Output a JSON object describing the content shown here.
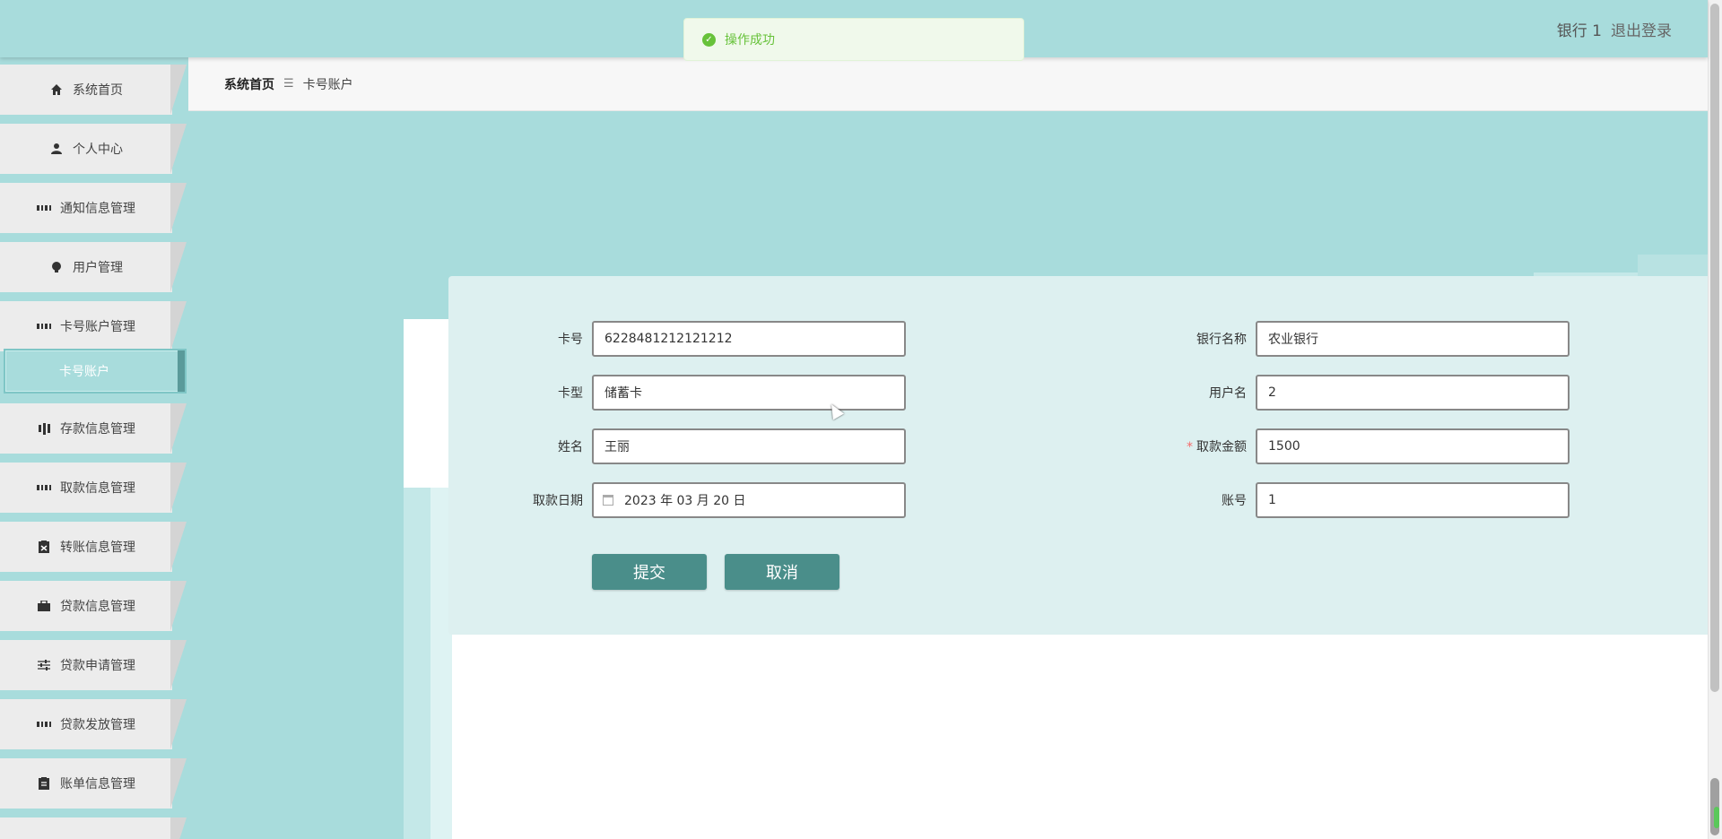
{
  "toast": {
    "message": "操作成功"
  },
  "header": {
    "user": "银行 1",
    "logout": "退出登录"
  },
  "sidebar": {
    "items": [
      {
        "label": "系统首页",
        "icon": "home-icon"
      },
      {
        "label": "个人中心",
        "icon": "user-icon"
      },
      {
        "label": "通知信息管理",
        "icon": "grid-icon"
      },
      {
        "label": "用户管理",
        "icon": "bulb-icon"
      },
      {
        "label": "卡号账户管理",
        "icon": "grid-icon"
      },
      {
        "label": "存款信息管理",
        "icon": "bar-chart-icon"
      },
      {
        "label": "取款信息管理",
        "icon": "grid-icon"
      },
      {
        "label": "转账信息管理",
        "icon": "clipboard-icon"
      },
      {
        "label": "贷款信息管理",
        "icon": "briefcase-icon"
      },
      {
        "label": "贷款申请管理",
        "icon": "sliders-icon"
      },
      {
        "label": "贷款发放管理",
        "icon": "grid-icon"
      },
      {
        "label": "账单信息管理",
        "icon": "clipboard-icon"
      }
    ],
    "active_sub": "卡号账户"
  },
  "breadcrumb": {
    "home": "系统首页",
    "separator": "☰",
    "current": "卡号账户"
  },
  "form": {
    "card_no": {
      "label": "卡号",
      "value": "6228481212121212"
    },
    "bank_name": {
      "label": "银行名称",
      "value": "农业银行"
    },
    "card_type": {
      "label": "卡型",
      "value": "储蓄卡"
    },
    "username": {
      "label": "用户名",
      "value": "2"
    },
    "name": {
      "label": "姓名",
      "value": "王丽"
    },
    "amount": {
      "label": "取款金额",
      "value": "1500",
      "required": "*"
    },
    "date": {
      "label": "取款日期",
      "value": "2023 年 03 月 20 日"
    },
    "account": {
      "label": "账号",
      "value": "1"
    },
    "submit": "提交",
    "cancel": "取消"
  },
  "colors": {
    "theme": "#a8dcdc",
    "button": "#4a8e8a",
    "success": "#67c23a"
  }
}
